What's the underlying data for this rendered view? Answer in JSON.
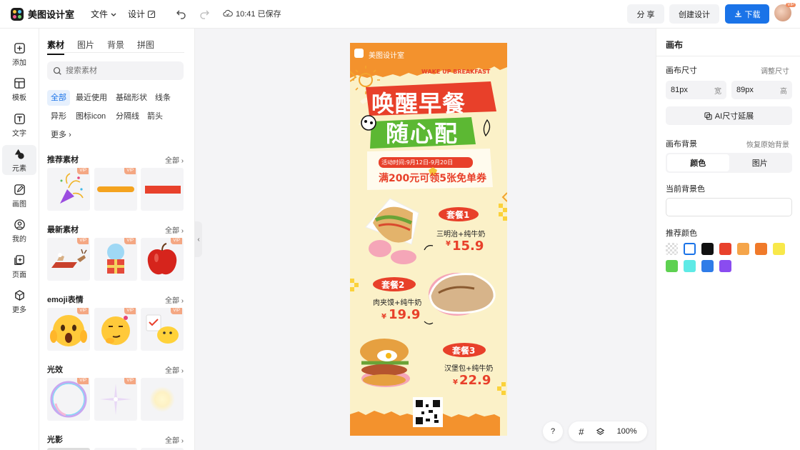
{
  "app": {
    "name": "美图设计室",
    "menu_file": "文件",
    "menu_design": "设计",
    "save_status": "10:41 已保存",
    "share_label": "分 享",
    "create_label": "创建设计",
    "download_label": "下载",
    "avatar_badge": "VIP"
  },
  "nav": [
    {
      "label": "添加",
      "icon": "plus-square-icon"
    },
    {
      "label": "模板",
      "icon": "template-icon"
    },
    {
      "label": "文字",
      "icon": "text-icon"
    },
    {
      "label": "元素",
      "icon": "shapes-icon",
      "active": true
    },
    {
      "label": "画图",
      "icon": "pen-icon"
    },
    {
      "label": "我的",
      "icon": "user-icon"
    },
    {
      "label": "页面",
      "icon": "page-add-icon"
    },
    {
      "label": "更多",
      "icon": "cube-icon"
    }
  ],
  "panel": {
    "tabs": [
      "素材",
      "图片",
      "背景",
      "拼图"
    ],
    "search_placeholder": "搜索素材",
    "chips": [
      "全部",
      "最近使用",
      "基础形状",
      "线条",
      "异形",
      "图标icon",
      "分隔线",
      "箭头",
      "更多"
    ],
    "sections": [
      {
        "title": "推荐素材",
        "all": "全部"
      },
      {
        "title": "最新素材",
        "all": "全部"
      },
      {
        "title": "emoji表情",
        "all": "全部"
      },
      {
        "title": "光效",
        "all": "全部"
      },
      {
        "title": "光影",
        "all": "全部"
      }
    ],
    "vip_label": "VIP"
  },
  "poster": {
    "brand": "美图设计室",
    "tagline": "WAKE UP BREAKFAST",
    "headline1": "唤醒早餐",
    "headline2": "随心配",
    "event_time": "活动时间:9月12日-9月20日",
    "promo_a": "满200元可",
    "promo_b": "领5",
    "promo_c": "张免单券",
    "sets": [
      {
        "title": "套餐1",
        "desc": "三明治+纯牛奶",
        "price": "15.9",
        "currency": "¥"
      },
      {
        "title": "套餐2",
        "desc": "肉夹馍+纯牛奶",
        "price": "19.9",
        "currency": "¥"
      },
      {
        "title": "套餐3",
        "desc": "汉堡包+纯牛奶",
        "price": "22.9",
        "currency": "¥"
      }
    ]
  },
  "controls": {
    "help": "?",
    "zoom": "100%"
  },
  "right": {
    "title": "画布",
    "size_label": "画布尺寸",
    "size_adjust": "调整尺寸",
    "width_value": "81px",
    "width_unit": "宽",
    "height_value": "89px",
    "height_unit": "高",
    "ai_extend": "AI尺寸延展",
    "bg_label": "画布背景",
    "bg_restore": "恢复原始背景",
    "seg_color": "颜色",
    "seg_image": "图片",
    "current_bg": "当前背景色",
    "recommend": "推荐颜色",
    "swatches": [
      "transparent",
      "#ffffff",
      "#111111",
      "#e8412c",
      "#f5a54a",
      "#f07a2a",
      "#f8e84a",
      "#5ed151",
      "#5eeae6",
      "#2f7ce8",
      "#8a4cf0"
    ]
  },
  "colors": {
    "accent": "#1a73e8",
    "poster_orange": "#f3922d",
    "poster_red": "#e8402a",
    "poster_green": "#5cb833"
  }
}
